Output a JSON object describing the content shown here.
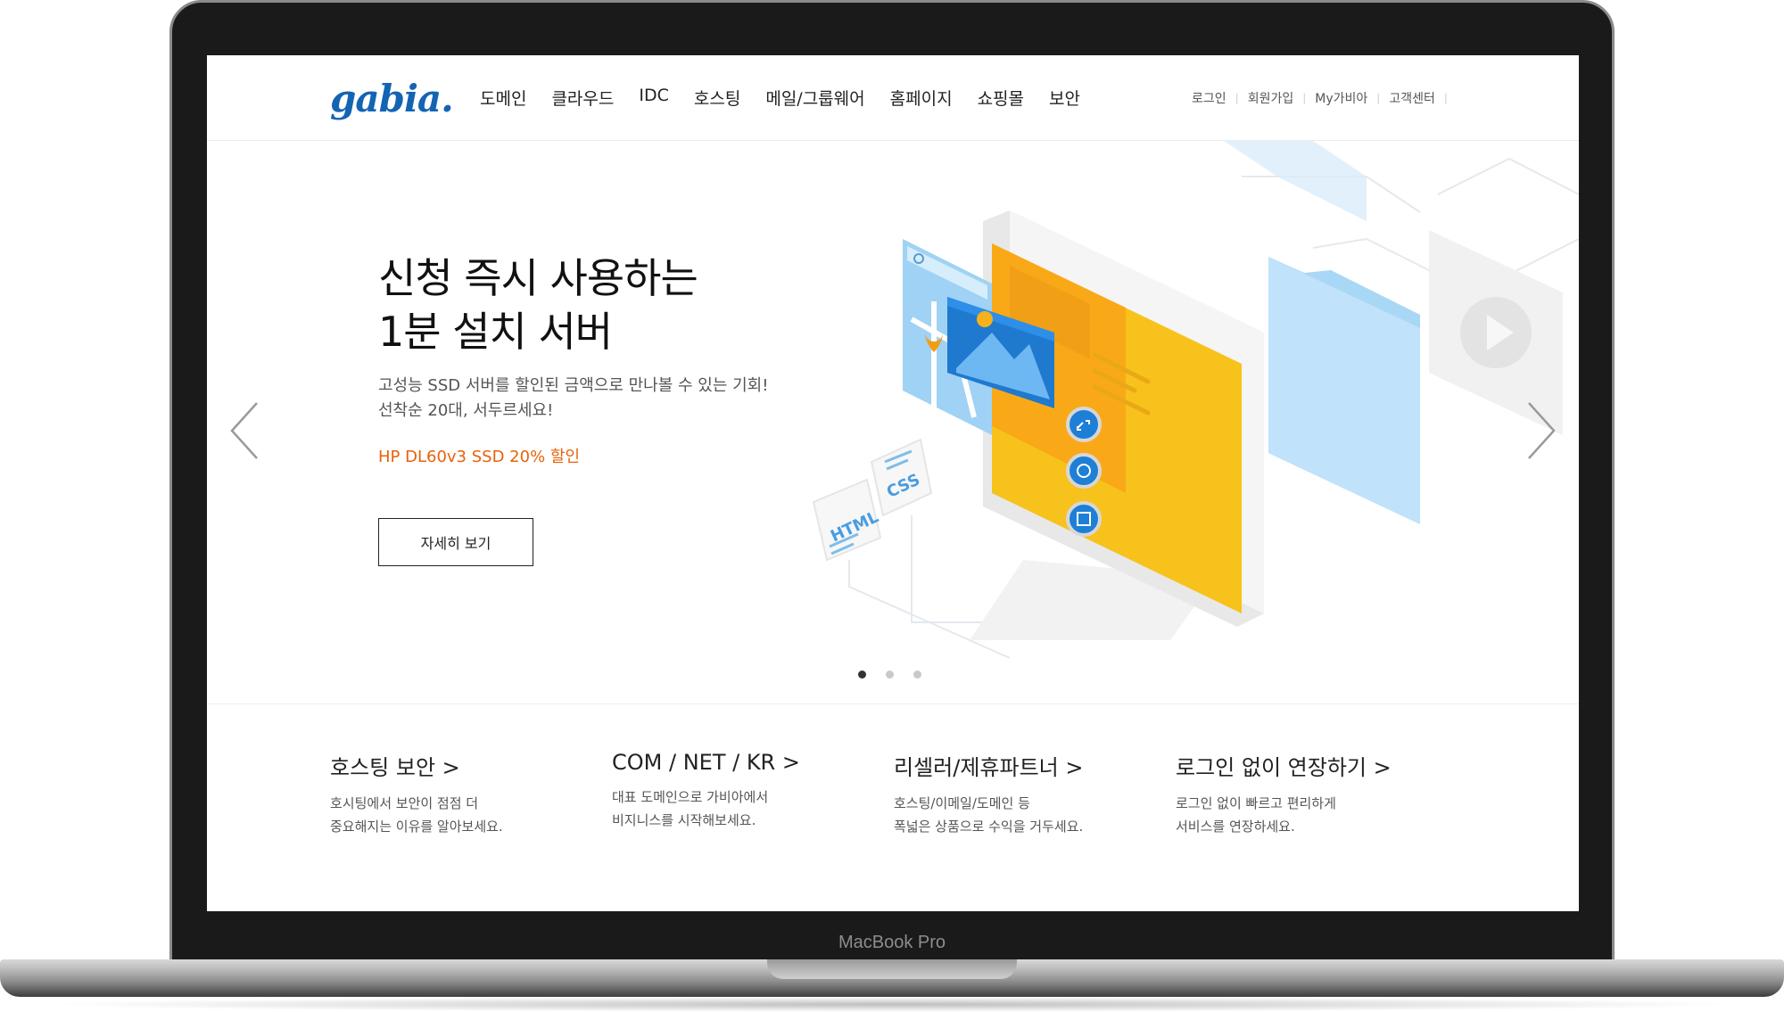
{
  "device": {
    "label": "MacBook Pro"
  },
  "header": {
    "logo": "gabia.",
    "nav": [
      "도메인",
      "클라우드",
      "IDC",
      "호스팅",
      "메일/그룹웨어",
      "홈페이지",
      "쇼핑몰",
      "보안"
    ],
    "util": [
      "로그인",
      "회원가입",
      "My가비아",
      "고객센터"
    ]
  },
  "hero": {
    "title_line1": "신청 즉시 사용하는",
    "title_line2": "1분 설치 서버",
    "desc_line1": "고성능 SSD 서버를 할인된 금액으로 만나볼 수 있는 기회!",
    "desc_line2": "선착순 20대, 서두르세요!",
    "promo": "HP DL60v3 SSD 20% 할인",
    "button": "자세히 보기",
    "illus_html": "HTML",
    "illus_css": "CSS",
    "slides": 3,
    "active_slide": 1
  },
  "quick": [
    {
      "title": "호스팅 보안 >",
      "desc1": "호시팅에서 보안이 점점 더",
      "desc2": "중요해지는 이유를 알아보세요."
    },
    {
      "title": "COM / NET / KR >",
      "desc1": "대표 도메인으로 가비아에서",
      "desc2": "비지니스를 시작해보세요."
    },
    {
      "title": "리셀러/제휴파트너 >",
      "desc1": "호스팅/이메일/도메인 등",
      "desc2": "폭넓은 상품으로 수익을 거두세요."
    },
    {
      "title": "로그인 없이 연장하기 >",
      "desc1": "로그인 없이 빠르고 편리하게",
      "desc2": "서비스를 연장하세요."
    }
  ],
  "colors": {
    "accent": "#e8620a",
    "brand": "#1464b4",
    "illus_yellow": "#f7c21c",
    "illus_blue": "#2a8ee0"
  }
}
